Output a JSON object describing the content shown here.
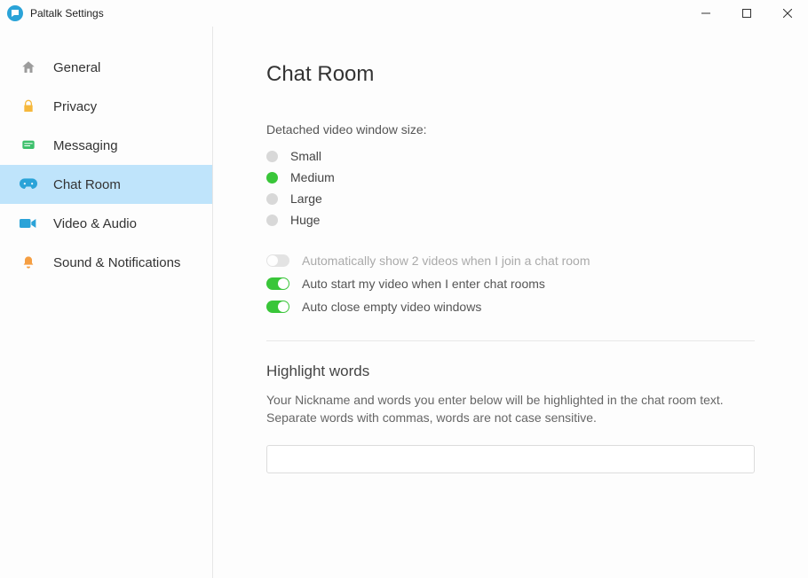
{
  "titlebar": {
    "title": "Paltalk Settings"
  },
  "sidebar": {
    "items": [
      {
        "label": "General"
      },
      {
        "label": "Privacy"
      },
      {
        "label": "Messaging"
      },
      {
        "label": "Chat Room"
      },
      {
        "label": "Video & Audio"
      },
      {
        "label": "Sound & Notifications"
      }
    ],
    "active_index": 3
  },
  "content": {
    "heading": "Chat Room",
    "video_size": {
      "label": "Detached video window size:",
      "options": [
        "Small",
        "Medium",
        "Large",
        "Huge"
      ],
      "selected_index": 1
    },
    "toggles": [
      {
        "label": "Automatically show 2 videos when I join a chat room",
        "on": false,
        "disabled": true
      },
      {
        "label": "Auto start my video when I enter chat rooms",
        "on": true,
        "disabled": false
      },
      {
        "label": "Auto close empty video windows",
        "on": true,
        "disabled": false
      }
    ],
    "highlight": {
      "title": "Highlight words",
      "desc": "Your Nickname and words you enter below will be highlighted in the chat room text. Separate words with commas, words are not case sensitive.",
      "value": ""
    }
  },
  "colors": {
    "accent_blue": "#2aa3d8",
    "sidebar_active": "#bfe4fb",
    "green": "#39c639"
  }
}
